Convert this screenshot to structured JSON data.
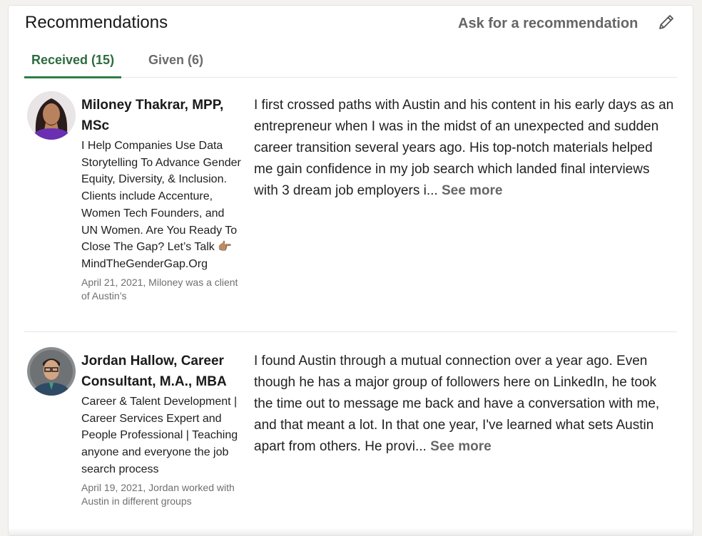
{
  "header": {
    "title": "Recommendations",
    "ask_label": "Ask for a recommendation",
    "edit_icon": "pencil-icon"
  },
  "tabs": [
    {
      "label": "Received (15)",
      "active": true
    },
    {
      "label": "Given (6)",
      "active": false
    }
  ],
  "recommendations": [
    {
      "name": "Miloney Thakrar, MPP, MSc",
      "headline": "I Help Companies Use Data Storytelling To Advance Gender Equity, Diversity, & Inclusion. Clients include Accenture, Women Tech Founders, and UN Women. Are You Ready To Close The Gap? Let’s Talk 👉🏽 MindTheGenderGap.Org",
      "meta": "April 21, 2021, Miloney was a client of Austin’s",
      "text": "I first crossed paths with Austin and his content in his early days as an entrepreneur when I was in the midst of an unexpected and sudden career transition several years ago. His top-notch materials helped me gain confidence in my job search which landed final interviews with 3 dream job employers i...",
      "see_more": "See more"
    },
    {
      "name": "Jordan Hallow, Career Consultant, M.A., MBA",
      "headline": "Career & Talent Development | Career Services Expert and People Professional | Teaching anyone and everyone the job search process",
      "meta": "April 19, 2021, Jordan worked with Austin in different groups",
      "text": "I found Austin through a mutual connection over a year ago. Even though he has a major group of followers here on LinkedIn, he took the time out to message me back and have a conversation with me, and that meant a lot. In that one year, I've learned what sets Austin apart from others. He provi...",
      "see_more": "See more"
    }
  ],
  "colors": {
    "accent_green": "#2e7d46",
    "muted_text": "#666666"
  }
}
